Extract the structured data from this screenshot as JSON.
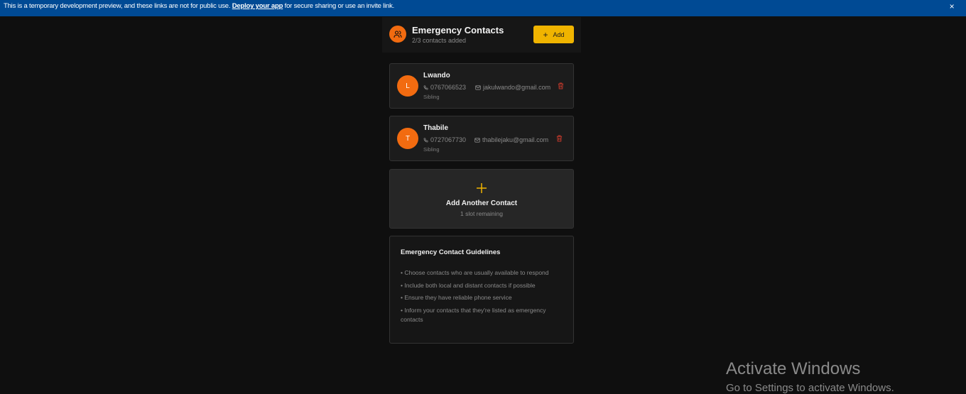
{
  "banner": {
    "text_before": "This is a temporary development preview, and these links are not for public use. ",
    "link": "Deploy your app",
    "text_after": " for secure sharing or use an invite link.",
    "close": "×"
  },
  "header": {
    "icon": "users-icon",
    "title": "Emergency Contacts",
    "subtitle": "2/3 contacts added",
    "add_label": "Add"
  },
  "contacts": [
    {
      "initial": "L",
      "name": "Lwando",
      "phone": "0767066523",
      "email": "jakulwando@gmail.com",
      "relation": "Sibling"
    },
    {
      "initial": "T",
      "name": "Thabile",
      "phone": "0727067730",
      "email": "thabilejaku@gmail.com",
      "relation": "Sibling"
    }
  ],
  "add_another": {
    "title": "Add Another Contact",
    "subtitle": "1 slot remaining"
  },
  "guidelines": {
    "title": "Emergency Contact Guidelines",
    "items": [
      "• Choose contacts who are usually available to respond",
      "• Include both local and distant contacts if possible",
      "• Ensure they have reliable phone service",
      "• Inform your contacts that they're listed as emergency contacts"
    ]
  },
  "watermark": {
    "title": "Activate Windows",
    "subtitle": "Go to Settings to activate Windows."
  },
  "colors": {
    "accent_orange": "#f26b10",
    "accent_yellow": "#f0b400",
    "banner_blue": "#004a94",
    "delete_red": "#c0392b"
  }
}
